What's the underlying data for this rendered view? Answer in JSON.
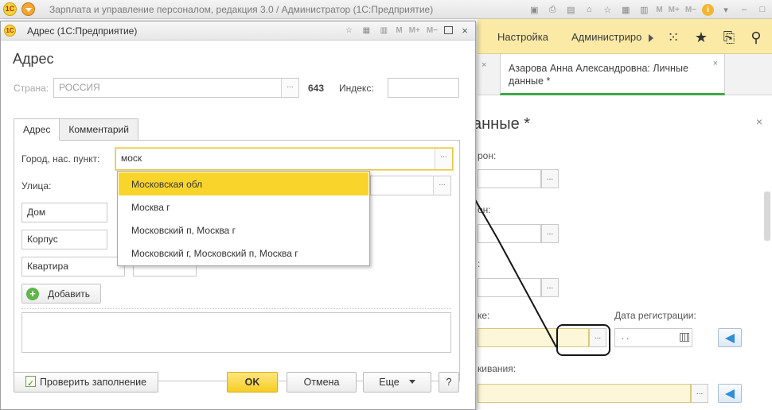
{
  "app": {
    "title": "Зарплата и управление персоналом, редакция 3.0 / Администратор  (1С:Предприятие)",
    "logo_text": "1С",
    "toolbar_m": "M",
    "toolbar_mplus": "M+",
    "toolbar_mminus": "M−",
    "info": "i"
  },
  "nav": {
    "settings": "Настройка",
    "admin": "Администриро"
  },
  "tab": {
    "label": "Азарова Анна Александровна: Личные данные *",
    "close": "×"
  },
  "bg_form": {
    "title": "анные *",
    "label1": "рон:",
    "label2": "он:",
    "label3": ":",
    "label4": "ке:",
    "label_date": "Дата регистрации:",
    "date_value": ".  .",
    "label5": "кивания:",
    "select": "..."
  },
  "dialog": {
    "window_title": "Адрес  (1С:Предприятие)",
    "heading": "Адрес",
    "country_label": "Страна:",
    "country_value": "РОССИЯ",
    "country_code": "643",
    "index_label": "Индекс:",
    "index_value": "",
    "tabs": [
      "Адрес",
      "Комментарий"
    ],
    "city_label": "Город, нас. пункт:",
    "city_value": "моск",
    "street_label": "Улица:",
    "house_label": "Дом",
    "korpus_label": "Корпус",
    "kvartira_label": "Квартира",
    "add_label": "Добавить",
    "select": "...",
    "check_label": "Проверить заполнение",
    "ok_label": "OK",
    "cancel_label": "Отмена",
    "more_label": "Еще",
    "help_label": "?"
  },
  "suggestions": [
    "Московская обл",
    "Москва г",
    "Московский п, Москва г",
    "Московский г, Московский п, Москва г"
  ],
  "colors": {
    "accent_yellow": "#f9d52b",
    "nav_bg": "#fbe9a6",
    "tab_underline": "#3fa74a"
  }
}
